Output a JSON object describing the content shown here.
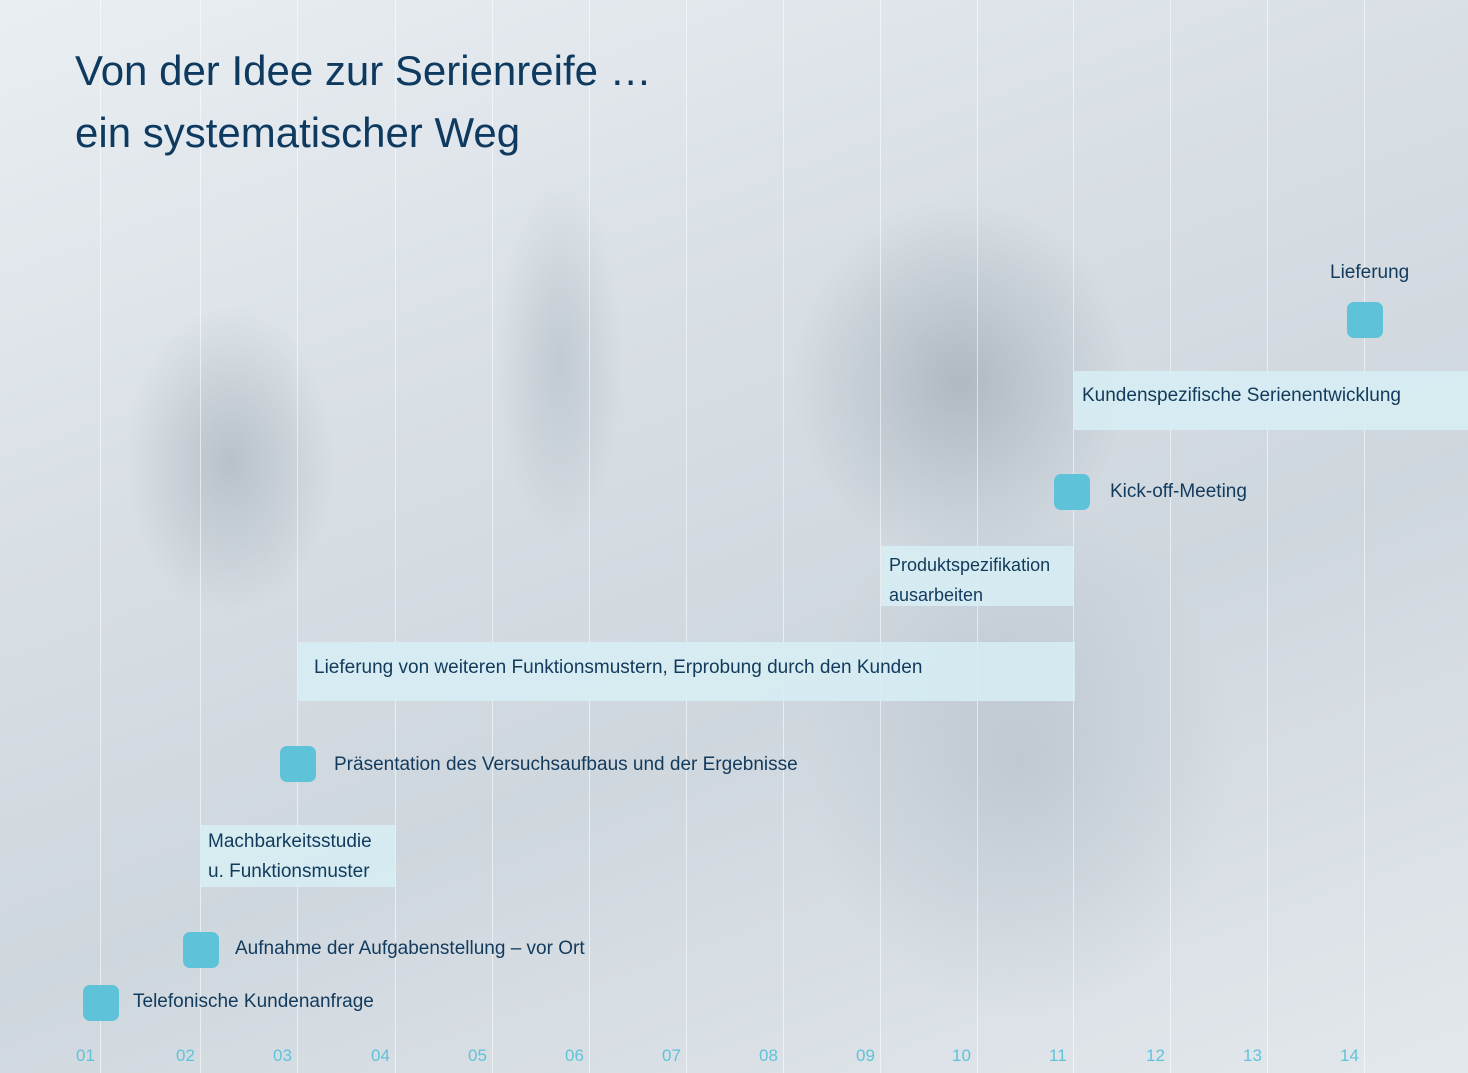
{
  "title": {
    "line1": "Von der Idee zur Serienreife …",
    "line2": "ein systematischer Weg"
  },
  "axis_ticks": [
    "01",
    "02",
    "03",
    "04",
    "05",
    "06",
    "07",
    "08",
    "09",
    "10",
    "11",
    "12",
    "13",
    "14"
  ],
  "colors": {
    "accent": "#5ec3d9",
    "text": "#123a5c",
    "band": "#d6eef4"
  },
  "steps": {
    "telefonisch": "Telefonische Kundenanfrage",
    "aufnahme": "Aufnahme der Aufgabenstellung – vor Ort",
    "machbarkeit_line1": "Machbarkeitsstudie",
    "machbarkeit_line2": "u. Funktionsmuster",
    "praesentation": "Präsentation des Versuchsaufbaus und der Ergebnisse",
    "lieferung_muster": "Lieferung von weiteren Funktionsmustern, Erprobung durch den Kunden",
    "produktspez_line1": "Produktspezifikation",
    "produktspez_line2": "ausarbeiten",
    "kickoff": "Kick-off-Meeting",
    "serienentwicklung": "Kundenspezifische Serienentwicklung",
    "lieferung": "Lieferung"
  }
}
